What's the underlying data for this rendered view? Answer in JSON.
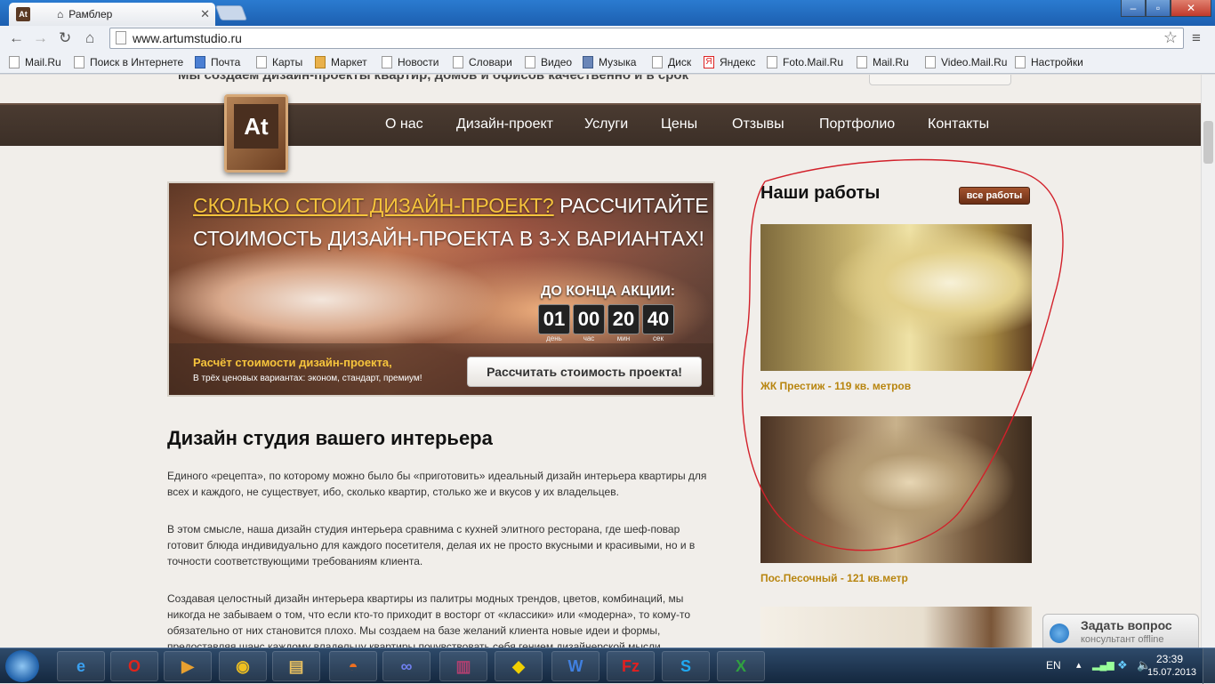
{
  "browser": {
    "tabs": [
      {
        "title": "Рамблер",
        "favicon": "At"
      },
      {
        "title": "",
        "favicon": ""
      }
    ],
    "address": "www.artumstudio.ru",
    "window_controls": {
      "minimize": "–",
      "maximize": "▫",
      "close": "✕"
    },
    "nav": {
      "back": "←",
      "forward": "→",
      "reload": "↻",
      "home": "⌂",
      "star": "☆",
      "menu": "≡"
    },
    "bookmarks": [
      "Mail.Ru",
      "Поиск в Интернете",
      "Почта",
      "Карты",
      "Маркет",
      "Новости",
      "Словари",
      "Видео",
      "Музыка",
      "Диск",
      "Яндекс",
      "Foto.Mail.Ru",
      "Mail.Ru",
      "Video.Mail.Ru",
      "Настройки"
    ]
  },
  "site": {
    "top_strip_text": "Мы создаем дизайн-проекты квартир, домов и офисов качественно и в срок",
    "logo_text": "At",
    "menu": [
      "О нас",
      "Дизайн-проект",
      "Услуги",
      "Цены",
      "Отзывы",
      "Портфолио",
      "Контакты"
    ],
    "banner": {
      "line1_highlight": "СКОЛЬКО СТОИТ ДИЗАЙН-ПРОЕКТ?",
      "line1_rest": "РАССЧИТАЙТЕ",
      "line2": "СТОИМОСТЬ ДИЗАЙН-ПРОЕКТА В 3-Х ВАРИАНТАХ!",
      "countdown_title": "ДО КОНЦА АКЦИИ:",
      "countdown": [
        {
          "value": "01",
          "unit": "день"
        },
        {
          "value": "00",
          "unit": "час"
        },
        {
          "value": "20",
          "unit": "мин"
        },
        {
          "value": "40",
          "unit": "сек"
        }
      ],
      "calc_title": "Расчёт стоимости дизайн-проекта,",
      "calc_sub": "В трёх ценовых вариантах: эконом, стандарт, премиум!",
      "calc_button": "Рассчитать стоимость проекта!"
    },
    "heading": "Дизайн студия вашего интерьера",
    "paragraphs": [
      "Единого «рецепта», по которому можно было бы «приготовить» идеальный дизайн интерьера квартиры для всех и каждого, не существует, ибо, сколько квартир, столько же и вкусов у их владельцев.",
      "В этом смысле, наша дизайн студия интерьера сравнима с кухней элитного ресторана, где шеф-повар готовит блюда индивидуально для каждого посетителя, делая их не просто вкусными и красивыми, но и в точности соответствующими требованиям клиента.",
      "Создавая целостный дизайн интерьера квартиры из палитры модных трендов, цветов, комбинаций, мы никогда не забываем о том, что если кто-то приходит в восторг от «классики» или «модерна», то кому-то обязательно от них становится плохо. Мы создаем на базе желаний клиента новые идеи и формы, предоставляя шанс каждому владельцу квартиры почувствовать себя гением дизайнерской мысли."
    ],
    "works_title": "Наши работы",
    "works_button": "все работы",
    "works": [
      {
        "caption": "ЖК Престиж - 119 кв. метров"
      },
      {
        "caption": "Пос.Песочный - 121 кв.метр"
      }
    ],
    "ask": {
      "title": "Задать вопрос",
      "subtitle": "консультант offline"
    }
  },
  "taskbar": {
    "lang": "EN",
    "time": "23:39",
    "date": "15.07.2013",
    "apps": [
      "start-orb",
      "ie",
      "opera",
      "media",
      "chrome",
      "explorer",
      "firefox",
      "infinity",
      "winrar",
      "batman",
      "word",
      "filezilla",
      "skype",
      "excel"
    ]
  },
  "colors": {
    "nav_bg": "#3c2f27",
    "accent_yellow": "#f6c43c",
    "caption_gold": "#b8850f",
    "button_brown": "#8a3f1f"
  }
}
